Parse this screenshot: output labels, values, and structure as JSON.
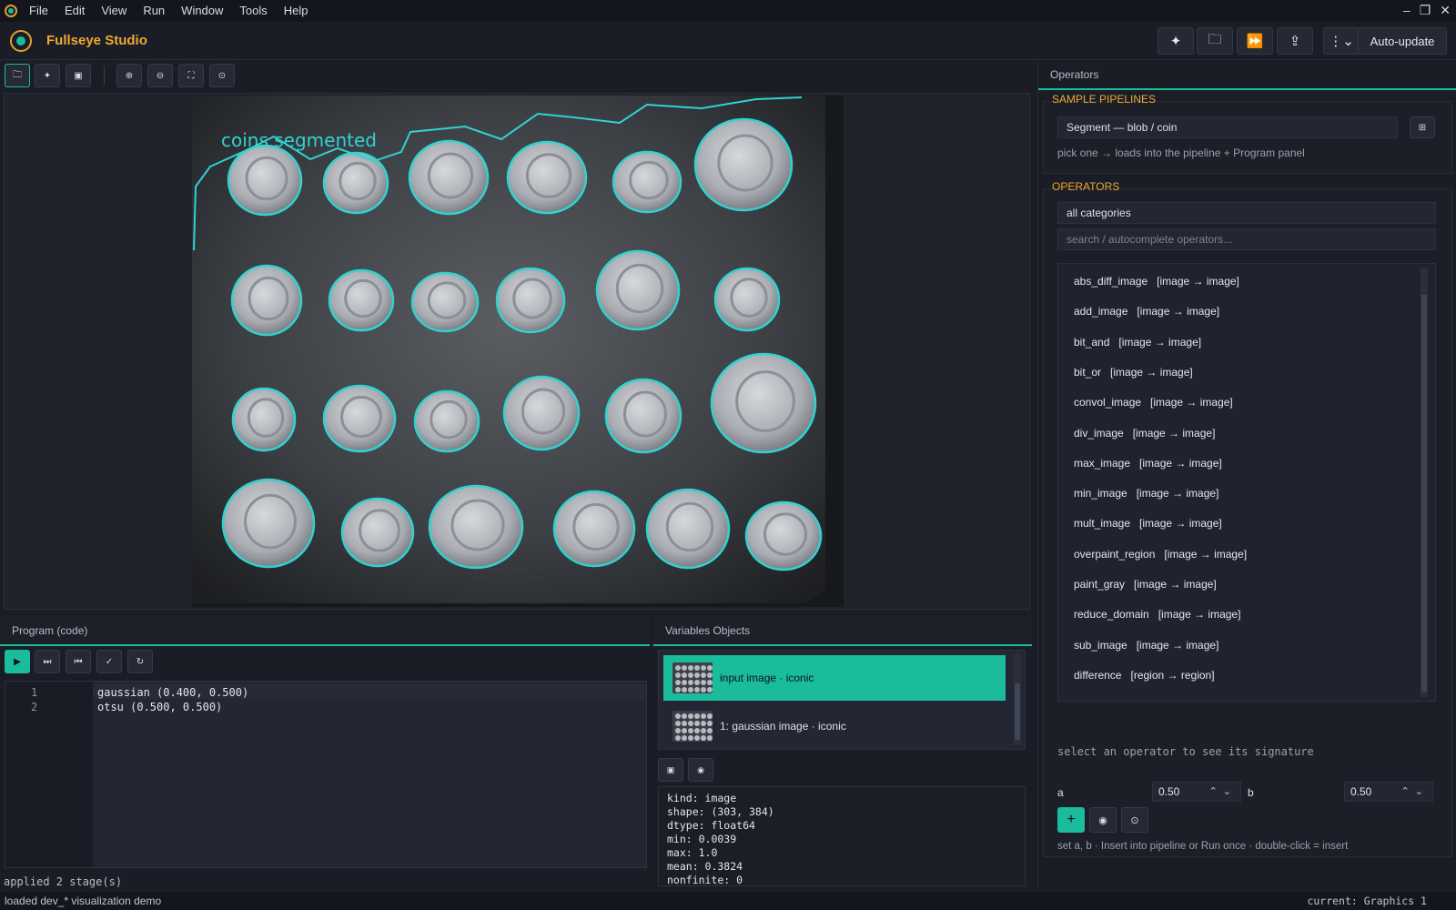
{
  "menu": [
    "File",
    "Edit",
    "View",
    "Run",
    "Window",
    "Tools",
    "Help"
  ],
  "app": {
    "title": "Fullseye Studio"
  },
  "toolbar": {
    "auto_update": "Auto-update"
  },
  "viewer": {
    "overlay_label": "coins segmented"
  },
  "program": {
    "header": "Program (code)",
    "lines": [
      {
        "num": "1",
        "code": "gaussian (0.400, 0.500)"
      },
      {
        "num": "2",
        "code": "otsu (0.500, 0.500)"
      }
    ],
    "status": "applied 2 stage(s)"
  },
  "variables": {
    "header": "Variables  Objects",
    "items": [
      {
        "label": "input   image · iconic"
      },
      {
        "label": "1: gaussian   image · iconic"
      }
    ],
    "info": [
      "kind: image",
      "shape: (303, 384)",
      "dtype: float64",
      "min: 0.0039",
      "max: 1.0",
      "mean: 0.3824",
      "nonfinite: 0"
    ]
  },
  "operators": {
    "header": "Operators",
    "sample_title": "SAMPLE PIPELINES",
    "sample_value": "Segment — blob / coin",
    "sample_hint": "pick one → loads into the pipeline + Program panel",
    "ops_title": "OPERATORS",
    "category": "all categories",
    "search_placeholder": "search / autocomplete operators...",
    "list": [
      "abs_diff_image   [image → image]",
      "add_image   [image → image]",
      "bit_and   [image → image]",
      "bit_or   [image → image]",
      "convol_image   [image → image]",
      "div_image   [image → image]",
      "max_image   [image → image]",
      "min_image   [image → image]",
      "mult_image   [image → image]",
      "overpaint_region   [image → image]",
      "paint_gray   [image → image]",
      "reduce_domain   [image → image]",
      "sub_image   [image → image]",
      "difference   [region → region]"
    ],
    "signature_hint": "select an operator to see its signature",
    "param_a_label": "a",
    "param_a_value": "0.50",
    "param_b_label": "b",
    "param_b_value": "0.50",
    "action_hint": "set a, b · Insert into pipeline or Run once · double-click = insert"
  },
  "status": {
    "left": "loaded dev_* visualization demo",
    "right": "current: Graphics 1"
  },
  "colors": {
    "accent": "#1abc9c",
    "brand": "#f0a830",
    "background": "#1a1d26"
  }
}
